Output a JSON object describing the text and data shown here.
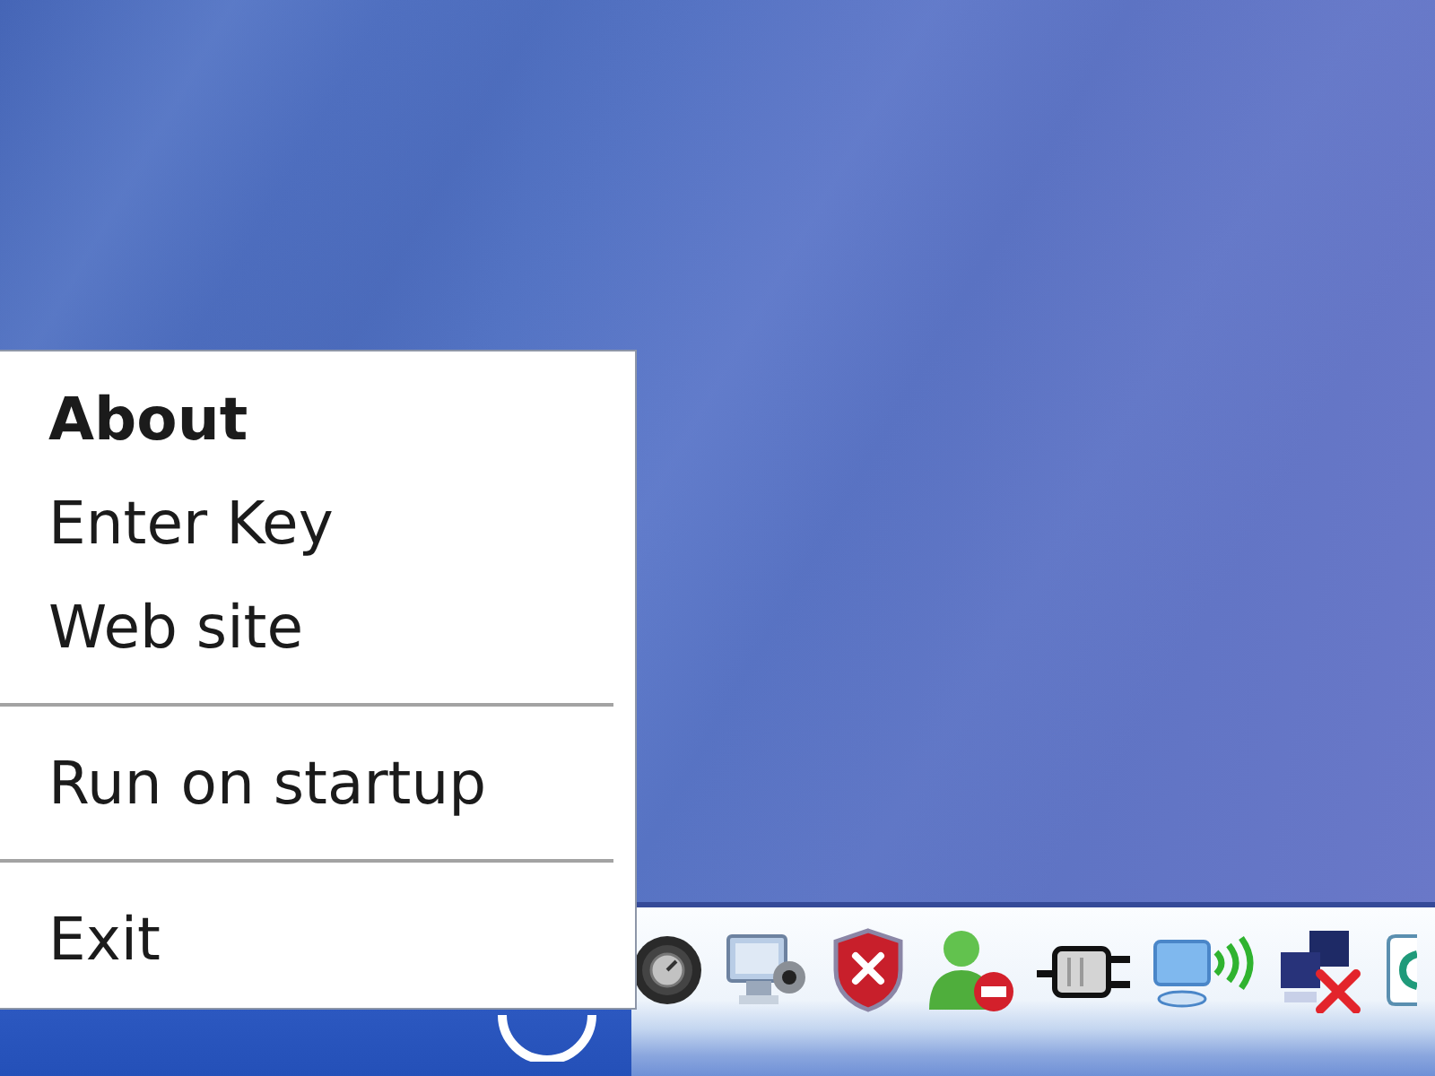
{
  "context_menu": {
    "groups": [
      {
        "items": [
          {
            "label": "About",
            "default": true
          },
          {
            "label": "Enter Key",
            "default": false
          },
          {
            "label": "Web site",
            "default": false
          }
        ]
      },
      {
        "items": [
          {
            "label": "Run on startup",
            "default": false
          }
        ]
      },
      {
        "items": [
          {
            "label": "Exit",
            "default": false
          }
        ]
      }
    ]
  }
}
